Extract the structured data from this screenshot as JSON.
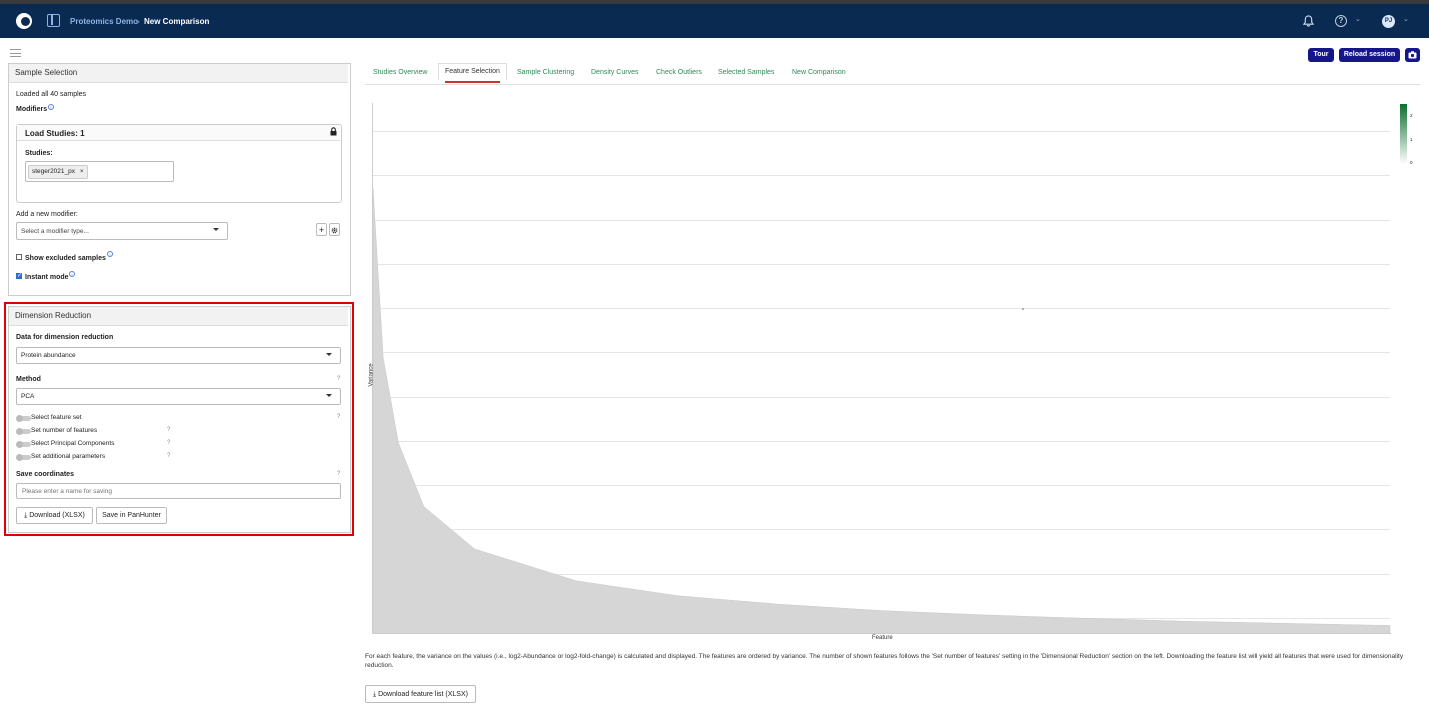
{
  "topbar": {
    "app_name": "Proteomics Demo",
    "separator": "›",
    "current_page": "New Comparison",
    "help_label": "?",
    "user_initials": "PJ",
    "chevron": "⌄"
  },
  "header_buttons": {
    "tour": "Tour",
    "reload": "Reload session"
  },
  "sample_selection": {
    "title": "Sample Selection",
    "loaded_text": "Loaded all 40 samples",
    "modifiers_label": "Modifiers",
    "load_studies_title": "Load Studies: 1",
    "studies_label": "Studies:",
    "study_tag": "steger2021_px",
    "study_tag_remove": "×",
    "add_modifier_label": "Add a new modifier:",
    "modifier_placeholder": "Select a modifier type...",
    "add_btn": "+",
    "show_excluded": "Show excluded samples",
    "instant_mode": "Instant mode"
  },
  "dimension_reduction": {
    "title": "Dimension Reduction",
    "data_label": "Data for dimension reduction",
    "data_value": "Protein abundance",
    "method_label": "Method",
    "method_value": "PCA",
    "q": "?",
    "options": [
      "Select feature set",
      "Set number of features",
      "Select Principal Components",
      "Set additional parameters"
    ],
    "save_label": "Save coordinates",
    "save_placeholder": "Please enter a name for saving",
    "download_btn": "Download (XLSX)",
    "save_btn": "Save in PanHunter",
    "highlight_color": "#e00000"
  },
  "tabs": [
    "Studies Overview",
    "Feature Selection",
    "Sample Clustering",
    "Density Curves",
    "Check Outliers",
    "Selected Samples",
    "New Comparison"
  ],
  "active_tab": "Feature Selection",
  "chart_data": {
    "type": "area",
    "xlabel": "Feature",
    "ylabel": "Variance",
    "x": [
      0,
      10,
      25,
      50,
      100,
      200,
      300,
      400,
      500,
      600,
      700,
      800,
      900,
      1000
    ],
    "y": [
      10.5,
      6.5,
      4.5,
      3.0,
      2.0,
      1.25,
      0.9,
      0.7,
      0.55,
      0.45,
      0.37,
      0.3,
      0.25,
      0.2
    ],
    "ylim": [
      0,
      12.5
    ],
    "grid": true,
    "colorbar_ticks": [
      "2",
      "1",
      "0"
    ],
    "colorbar_colors": [
      "#0b6e2e",
      "#ffffff"
    ]
  },
  "description": "For each feature, the variance on the values (i.e., log2-Abundance or log2-fold-change) is calculated and displayed. The features are ordered by variance. The number of shown features follows the 'Set number of features' setting in the 'Dimensional Reduction' section on the left. Downloading the feature list will yield all features that were used for dimensionality reduction.",
  "download_feature_list": "Download feature list (XLSX)"
}
